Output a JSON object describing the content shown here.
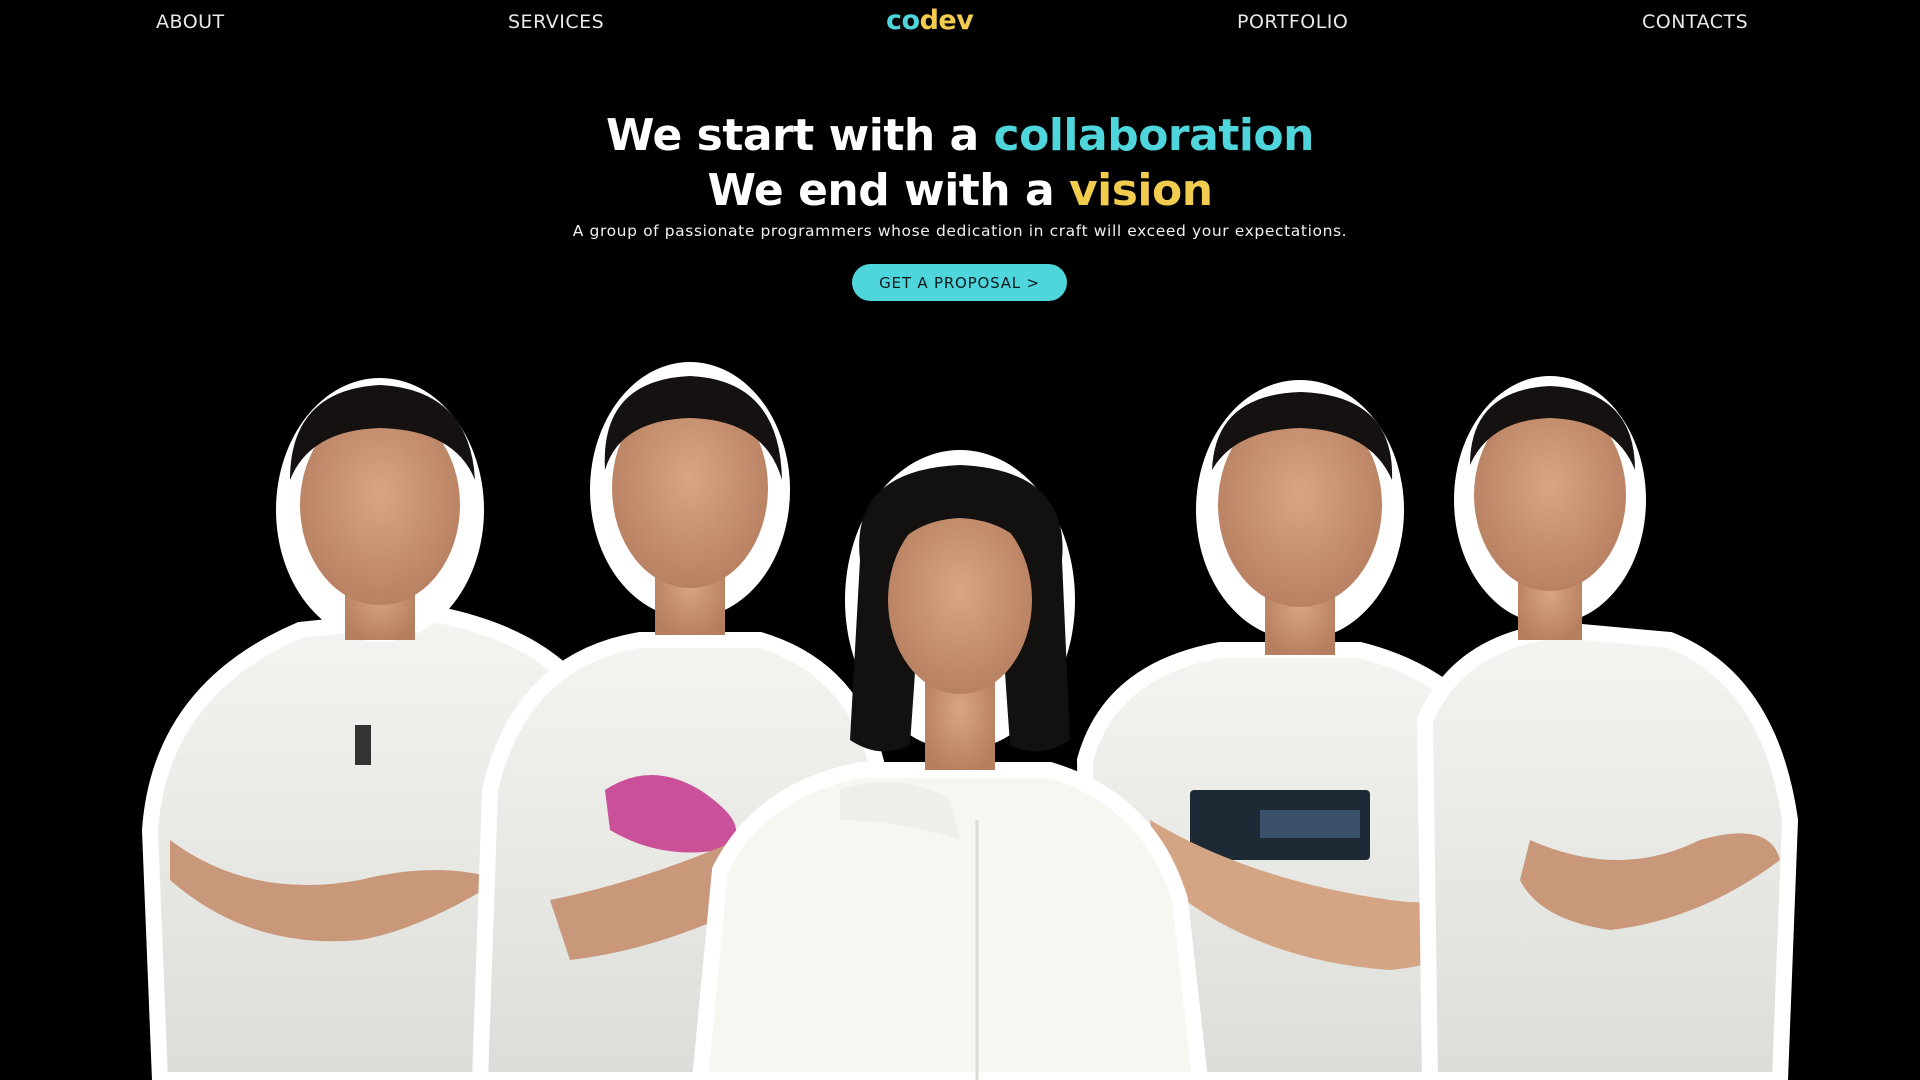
{
  "nav": {
    "about": "ABOUT",
    "services": "SERVICES",
    "portfolio": "PORTFOLIO",
    "contacts": "CONTACTS"
  },
  "logo": {
    "part1": "co",
    "part2": "dev"
  },
  "hero": {
    "line1_prefix": "We start with a ",
    "line1_accent": "collaboration",
    "line2_prefix": "We end with a ",
    "line2_accent": "vision",
    "subtitle": "A group of passionate programmers whose dedication in craft will exceed your expectations.",
    "cta_label": "GET A PROPOSAL >"
  },
  "colors": {
    "background": "#000000",
    "accent_cyan": "#4fd6dc",
    "accent_yellow": "#f1cc4f",
    "text": "#ffffff"
  }
}
